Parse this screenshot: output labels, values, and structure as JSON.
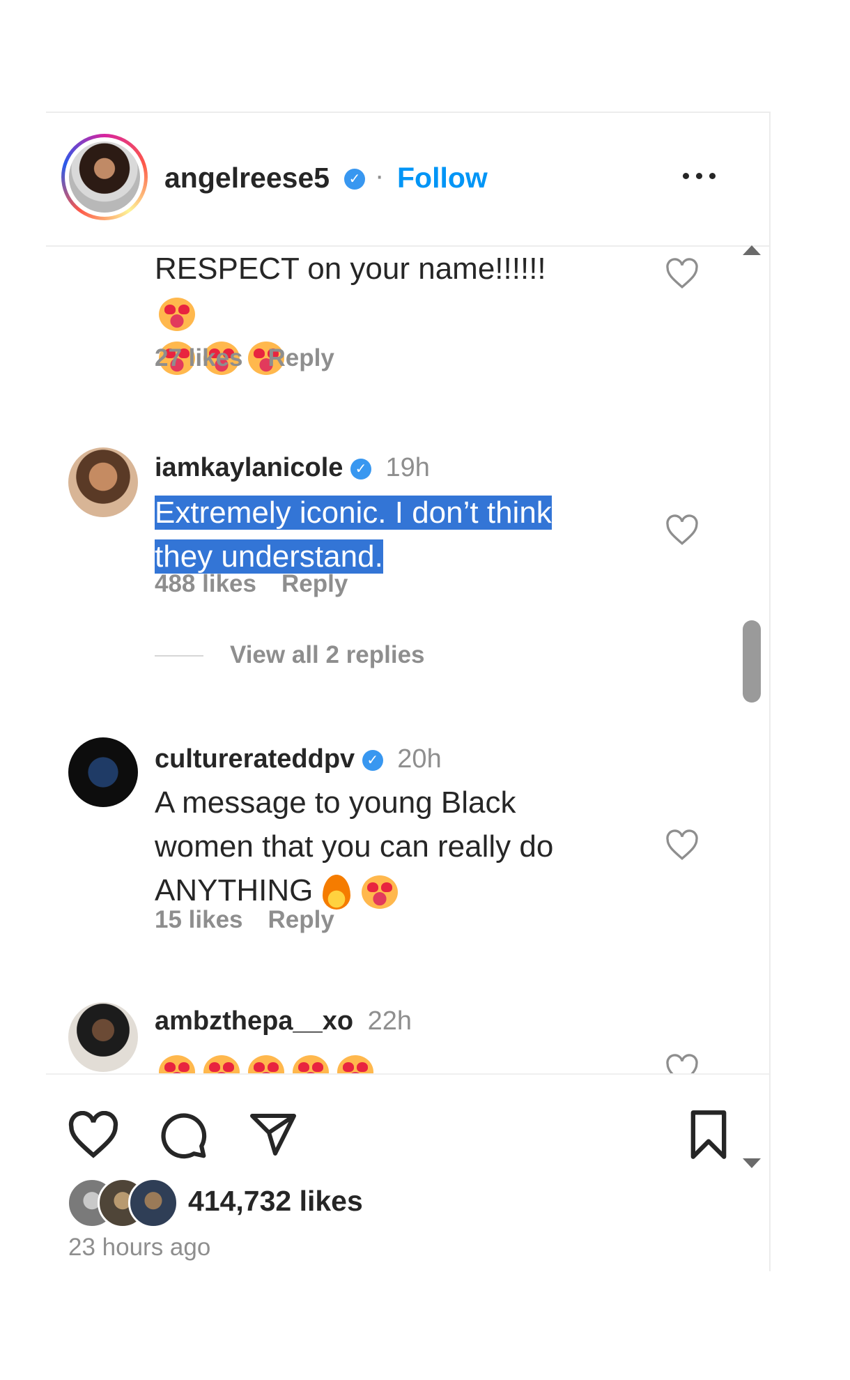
{
  "post_header": {
    "username": "angelreese5",
    "separator": "·",
    "follow_label": "Follow",
    "more_icon": "more-horizontal-icon"
  },
  "comments": [
    {
      "text": "RESPECT on your name!!!!!!",
      "emoji_icon": "heart-eyes-emoji",
      "likes": "27 likes",
      "reply_label": "Reply"
    },
    {
      "username": "iamkaylanicole",
      "time": "19h",
      "text": "Extremely iconic. I don’t think they understand.",
      "text_line1": "Extremely iconic. I don’t think",
      "text_line2": "they understand.",
      "likes": "488 likes",
      "reply_label": "Reply",
      "view_replies": "View all 2 replies"
    },
    {
      "username": "culturerateddpv",
      "time": "20h",
      "text_line1": "A message to young Black",
      "text_line2": "women that you can really do",
      "text_line3": "ANYTHING",
      "likes": "15 likes",
      "reply_label": "Reply"
    },
    {
      "username": "ambzthepa__xo",
      "time": "22h"
    }
  ],
  "actions": {
    "like_icon": "heart-icon",
    "comment_icon": "comment-icon",
    "share_icon": "send-icon",
    "save_icon": "bookmark-icon",
    "likes_count": "414,732 likes",
    "posted_time": "23 hours ago"
  },
  "colors": {
    "accent": "#0095f6",
    "highlight": "#3375d6",
    "verified": "#3897f0",
    "muted_text": "#8e8e8e"
  }
}
